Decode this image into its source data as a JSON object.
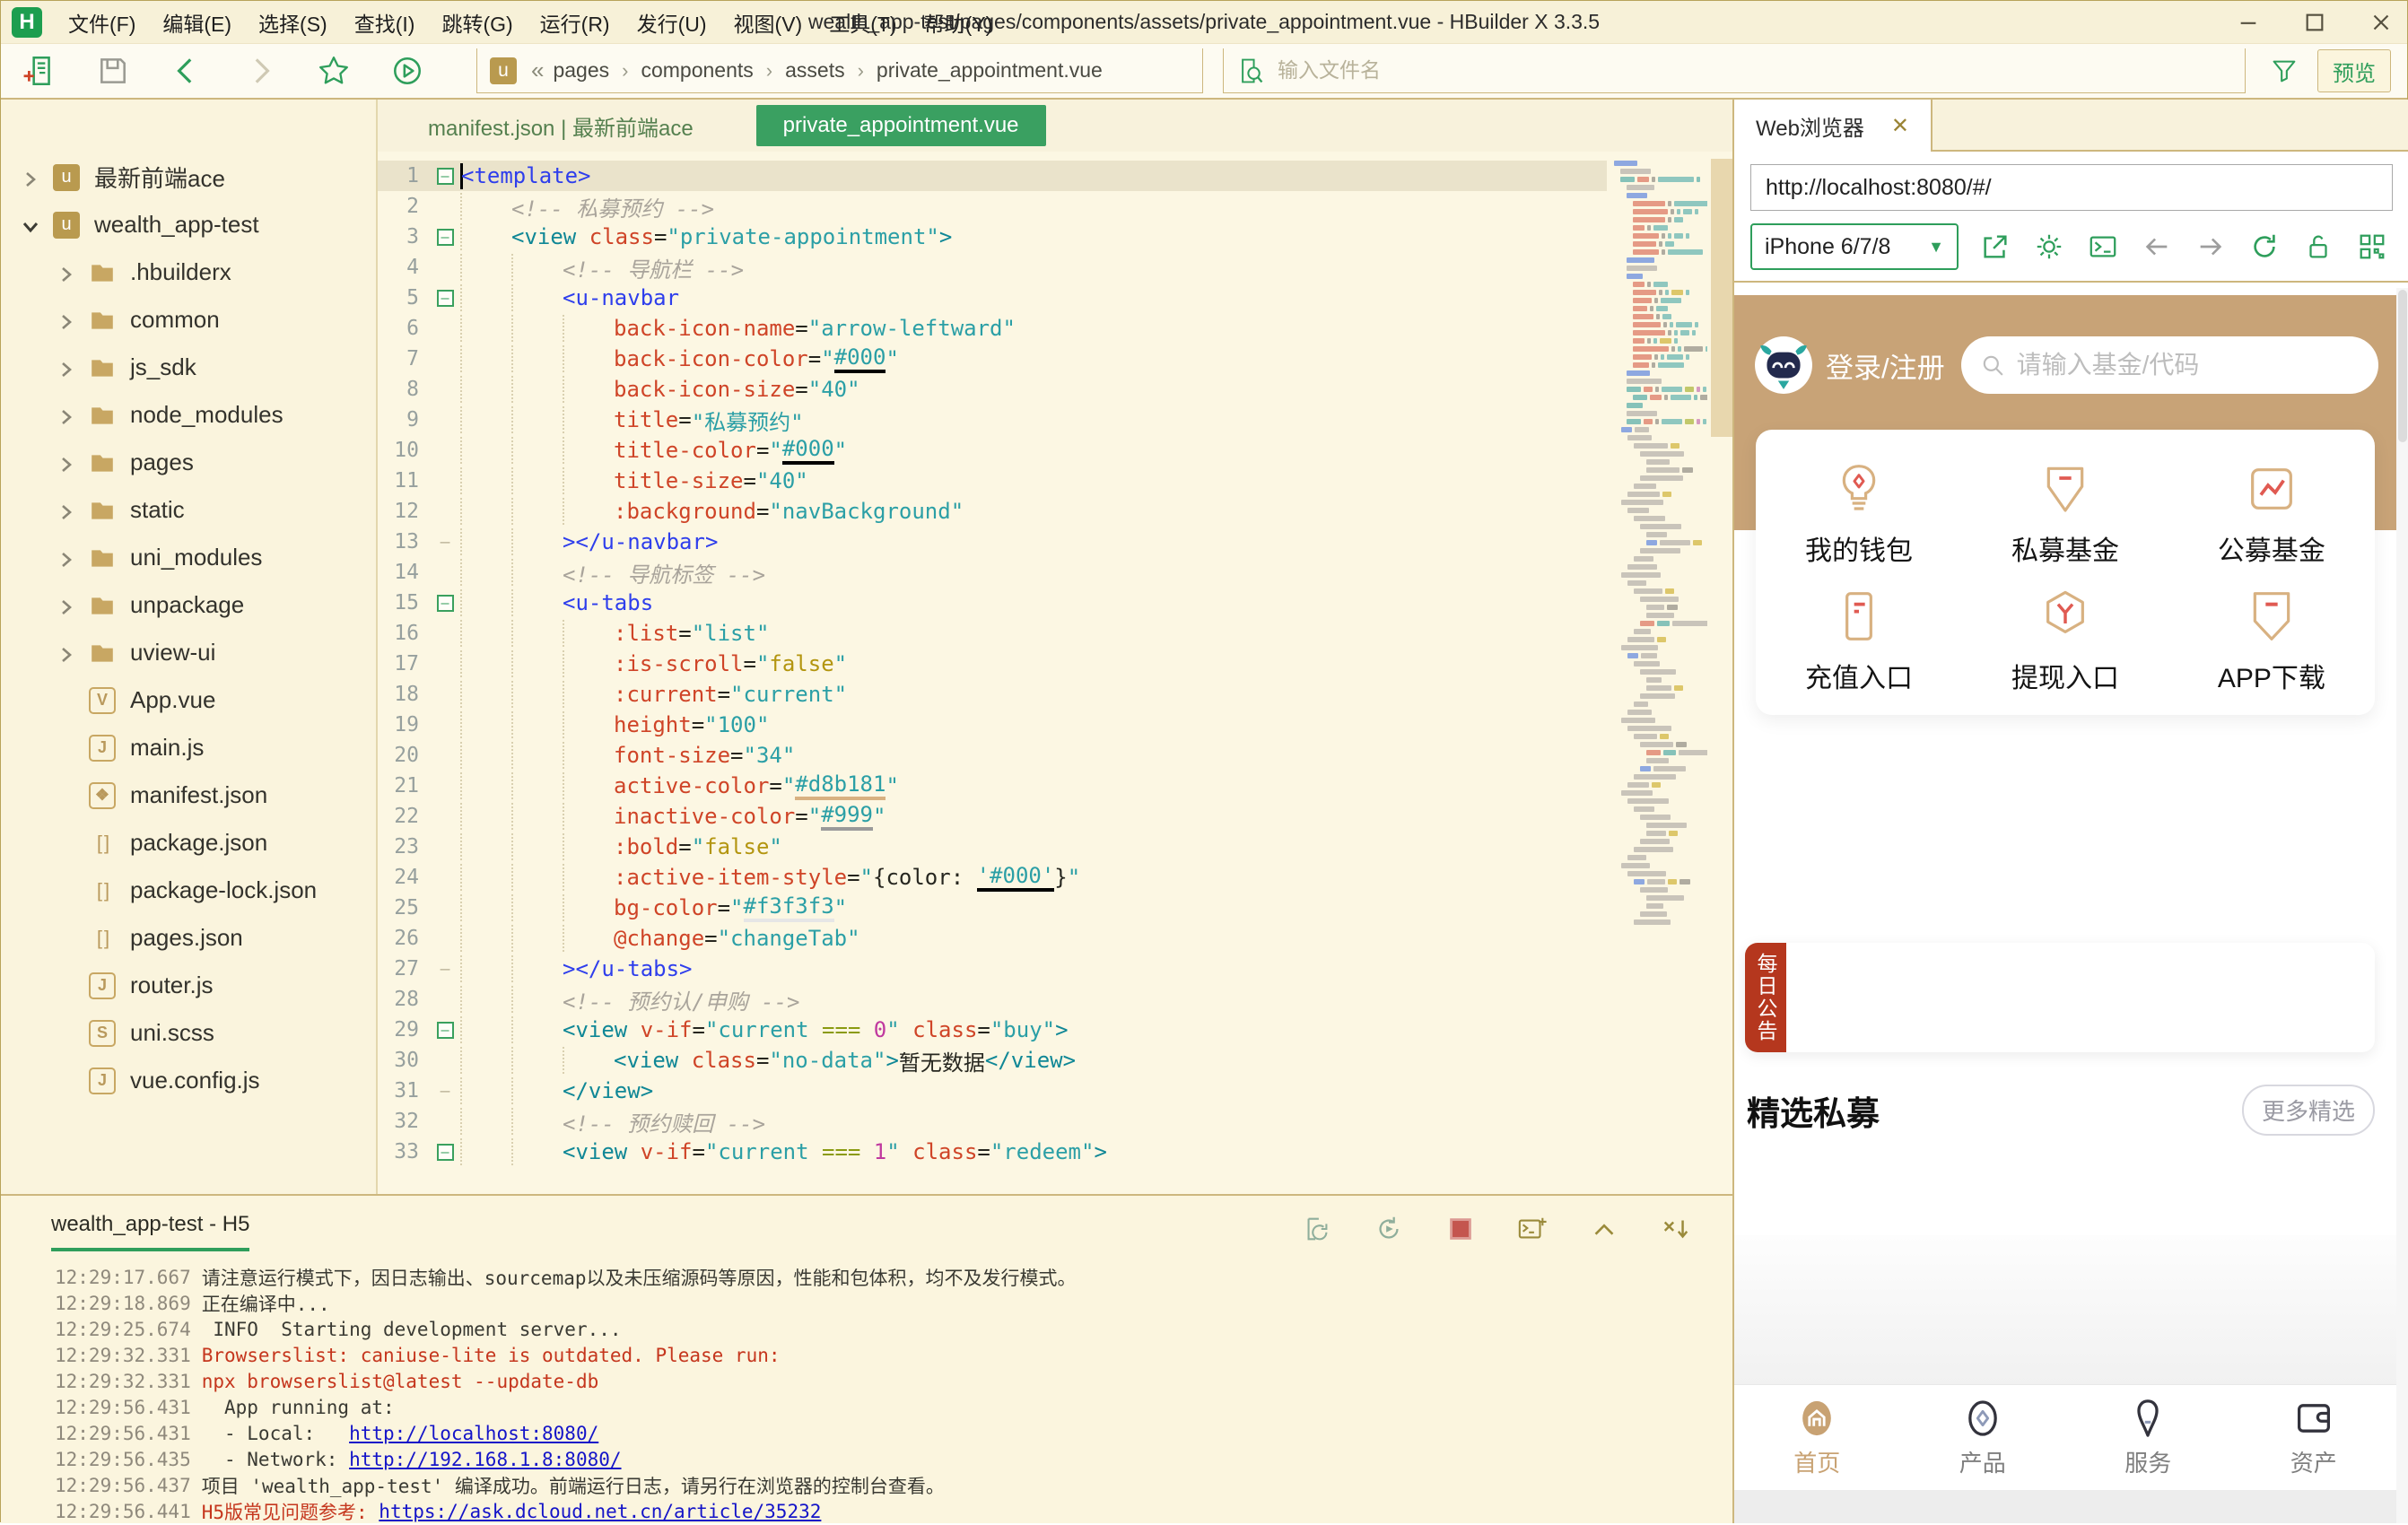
{
  "colors": {
    "accent_green": "#2e9e5b",
    "tab_green": "#3aa061",
    "app_tan": "#c8a377",
    "badge_red": "#b5371e",
    "gold_border": "#cdb77e",
    "active_color_value": "#d8b181"
  },
  "window": {
    "logo_letter": "H",
    "menus": [
      "文件(F)",
      "编辑(E)",
      "选择(S)",
      "查找(I)",
      "跳转(G)",
      "运行(R)",
      "发行(U)",
      "视图(V)",
      "工具(T)",
      "帮助(Y)"
    ],
    "title": "wealth_app-test/pages/components/assets/private_appointment.vue - HBuilder X 3.3.5"
  },
  "toolbar": {
    "home_crumb": "«",
    "crumbs": [
      "pages",
      "components",
      "assets",
      "private_appointment.vue"
    ],
    "search_placeholder": "输入文件名",
    "preview_label": "预览"
  },
  "explorer": {
    "items": [
      {
        "label": "最新前端ace",
        "kind": "project",
        "expanded": false
      },
      {
        "label": "wealth_app-test",
        "kind": "project",
        "expanded": true
      },
      {
        "label": ".hbuilderx",
        "kind": "folder"
      },
      {
        "label": "common",
        "kind": "folder"
      },
      {
        "label": "js_sdk",
        "kind": "folder"
      },
      {
        "label": "node_modules",
        "kind": "folder"
      },
      {
        "label": "pages",
        "kind": "folder"
      },
      {
        "label": "static",
        "kind": "folder"
      },
      {
        "label": "uni_modules",
        "kind": "folder"
      },
      {
        "label": "unpackage",
        "kind": "folder"
      },
      {
        "label": "uview-ui",
        "kind": "folder"
      },
      {
        "label": "App.vue",
        "kind": "file",
        "icon": "vue"
      },
      {
        "label": "main.js",
        "kind": "file",
        "icon": "js"
      },
      {
        "label": "manifest.json",
        "kind": "file",
        "icon": "manifest"
      },
      {
        "label": "package.json",
        "kind": "file",
        "icon": "brackets"
      },
      {
        "label": "package-lock.json",
        "kind": "file",
        "icon": "brackets"
      },
      {
        "label": "pages.json",
        "kind": "file",
        "icon": "brackets"
      },
      {
        "label": "router.js",
        "kind": "file",
        "icon": "js"
      },
      {
        "label": "uni.scss",
        "kind": "file",
        "icon": "scss"
      },
      {
        "label": "vue.config.js",
        "kind": "file",
        "icon": "js"
      }
    ]
  },
  "editor": {
    "tabs": [
      {
        "label": "manifest.json | 最新前端ace",
        "active": false
      },
      {
        "label": "private_appointment.vue",
        "active": true
      }
    ],
    "lines": [
      {
        "n": 1,
        "i": 0,
        "f": "m",
        "cur": true,
        "tk": [
          [
            "<template>",
            "tb"
          ]
        ]
      },
      {
        "n": 2,
        "i": 1,
        "tk": [
          [
            "<!-- 私募预约 -->",
            "cm"
          ]
        ]
      },
      {
        "n": 3,
        "i": 1,
        "f": "m",
        "tk": [
          [
            "<view ",
            "tt"
          ],
          [
            "class",
            "at"
          ],
          [
            "=",
            "pl"
          ],
          [
            "\"private-appointment\"",
            "st"
          ],
          [
            ">",
            "tt"
          ]
        ]
      },
      {
        "n": 4,
        "i": 2,
        "tk": [
          [
            "<!-- 导航栏 -->",
            "cm"
          ]
        ]
      },
      {
        "n": 5,
        "i": 2,
        "f": "m",
        "tk": [
          [
            "<u-navbar",
            "tb"
          ]
        ]
      },
      {
        "n": 6,
        "i": 3,
        "tk": [
          [
            "back-icon-name",
            "at"
          ],
          [
            "=",
            "pl"
          ],
          [
            "\"arrow-leftward\"",
            "st"
          ]
        ]
      },
      {
        "n": 7,
        "i": 3,
        "tk": [
          [
            "back-icon-color",
            "at"
          ],
          [
            "=",
            "pl"
          ],
          [
            "\"",
            "st"
          ],
          [
            "#000",
            "st ub"
          ],
          [
            "\"",
            "st"
          ]
        ]
      },
      {
        "n": 8,
        "i": 3,
        "tk": [
          [
            "back-icon-size",
            "at"
          ],
          [
            "=",
            "pl"
          ],
          [
            "\"40\"",
            "st"
          ]
        ]
      },
      {
        "n": 9,
        "i": 3,
        "tk": [
          [
            "title",
            "at"
          ],
          [
            "=",
            "pl"
          ],
          [
            "\"私募预约\"",
            "st"
          ]
        ]
      },
      {
        "n": 10,
        "i": 3,
        "tk": [
          [
            "title-color",
            "at"
          ],
          [
            "=",
            "pl"
          ],
          [
            "\"",
            "st"
          ],
          [
            "#000",
            "st ub"
          ],
          [
            "\"",
            "st"
          ]
        ]
      },
      {
        "n": 11,
        "i": 3,
        "tk": [
          [
            "title-size",
            "at"
          ],
          [
            "=",
            "pl"
          ],
          [
            "\"40\"",
            "st"
          ]
        ]
      },
      {
        "n": 12,
        "i": 3,
        "tk": [
          [
            ":background",
            "at"
          ],
          [
            "=",
            "pl"
          ],
          [
            "\"navBackground\"",
            "st"
          ]
        ]
      },
      {
        "n": 13,
        "i": 2,
        "f": "e",
        "tk": [
          [
            "></u-navbar>",
            "tb"
          ]
        ]
      },
      {
        "n": 14,
        "i": 2,
        "tk": [
          [
            "<!-- 导航标签 -->",
            "cm"
          ]
        ]
      },
      {
        "n": 15,
        "i": 2,
        "f": "m",
        "tk": [
          [
            "<u-tabs",
            "tb"
          ]
        ]
      },
      {
        "n": 16,
        "i": 3,
        "tk": [
          [
            ":list",
            "at"
          ],
          [
            "=",
            "pl"
          ],
          [
            "\"list\"",
            "st"
          ]
        ]
      },
      {
        "n": 17,
        "i": 3,
        "tk": [
          [
            ":is-scroll",
            "at"
          ],
          [
            "=",
            "pl"
          ],
          [
            "\"",
            "st"
          ],
          [
            "false",
            "kf"
          ],
          [
            "\"",
            "st"
          ]
        ]
      },
      {
        "n": 18,
        "i": 3,
        "tk": [
          [
            ":current",
            "at"
          ],
          [
            "=",
            "pl"
          ],
          [
            "\"current\"",
            "st"
          ]
        ]
      },
      {
        "n": 19,
        "i": 3,
        "tk": [
          [
            "height",
            "at"
          ],
          [
            "=",
            "pl"
          ],
          [
            "\"100\"",
            "st"
          ]
        ]
      },
      {
        "n": 20,
        "i": 3,
        "tk": [
          [
            "font-size",
            "at"
          ],
          [
            "=",
            "pl"
          ],
          [
            "\"34\"",
            "st"
          ]
        ]
      },
      {
        "n": 21,
        "i": 3,
        "tk": [
          [
            "active-color",
            "at"
          ],
          [
            "=",
            "pl"
          ],
          [
            "\"",
            "st"
          ],
          [
            "#d8b181",
            "st ut"
          ],
          [
            "\"",
            "st"
          ]
        ]
      },
      {
        "n": 22,
        "i": 3,
        "tk": [
          [
            "inactive-color",
            "at"
          ],
          [
            "=",
            "pl"
          ],
          [
            "\"",
            "st"
          ],
          [
            "#999",
            "st ug"
          ],
          [
            "\"",
            "st"
          ]
        ]
      },
      {
        "n": 23,
        "i": 3,
        "tk": [
          [
            ":bold",
            "at"
          ],
          [
            "=",
            "pl"
          ],
          [
            "\"",
            "st"
          ],
          [
            "false",
            "kf"
          ],
          [
            "\"",
            "st"
          ]
        ]
      },
      {
        "n": 24,
        "i": 3,
        "tk": [
          [
            ":active-item-style",
            "at"
          ],
          [
            "=",
            "pl"
          ],
          [
            "\"",
            "st"
          ],
          [
            "{color: ",
            "pl"
          ],
          [
            "'#000'",
            "st ub"
          ],
          [
            "}",
            "pl"
          ],
          [
            "\"",
            "st"
          ]
        ]
      },
      {
        "n": 25,
        "i": 3,
        "tk": [
          [
            "bg-color",
            "at"
          ],
          [
            "=",
            "pl"
          ],
          [
            "\"",
            "st"
          ],
          [
            "#f3f3f3",
            "st uf"
          ],
          [
            "\"",
            "st"
          ]
        ]
      },
      {
        "n": 26,
        "i": 3,
        "tk": [
          [
            "@change",
            "at"
          ],
          [
            "=",
            "pl"
          ],
          [
            "\"changeTab\"",
            "st"
          ]
        ]
      },
      {
        "n": 27,
        "i": 2,
        "f": "e",
        "tk": [
          [
            "></u-tabs>",
            "tb"
          ]
        ]
      },
      {
        "n": 28,
        "i": 2,
        "tk": [
          [
            "<!-- 预约认/申购 -->",
            "cm"
          ]
        ]
      },
      {
        "n": 29,
        "i": 2,
        "f": "m",
        "tk": [
          [
            "<view ",
            "tt"
          ],
          [
            "v-if",
            "at"
          ],
          [
            "=",
            "pl"
          ],
          [
            "\"current ",
            "st"
          ],
          [
            "=== ",
            "op"
          ],
          [
            "0",
            "nm"
          ],
          [
            "\"",
            "st"
          ],
          [
            " ",
            "pl"
          ],
          [
            "class",
            "at"
          ],
          [
            "=",
            "pl"
          ],
          [
            "\"buy\"",
            "st"
          ],
          [
            ">",
            "tt"
          ]
        ]
      },
      {
        "n": 30,
        "i": 3,
        "tk": [
          [
            "<view ",
            "tt"
          ],
          [
            "class",
            "at"
          ],
          [
            "=",
            "pl"
          ],
          [
            "\"no-data\"",
            "st"
          ],
          [
            ">",
            "tt"
          ],
          [
            "暂无数据",
            "pl"
          ],
          [
            "</view>",
            "tt"
          ]
        ]
      },
      {
        "n": 31,
        "i": 2,
        "f": "e",
        "tk": [
          [
            "</view>",
            "tt"
          ]
        ]
      },
      {
        "n": 32,
        "i": 2,
        "tk": [
          [
            "<!-- 预约赎回 -->",
            "cm"
          ]
        ]
      },
      {
        "n": 33,
        "i": 2,
        "f": "m",
        "tk": [
          [
            "<view ",
            "tt"
          ],
          [
            "v-if",
            "at"
          ],
          [
            "=",
            "pl"
          ],
          [
            "\"current ",
            "st"
          ],
          [
            "=== ",
            "op"
          ],
          [
            "1",
            "nm"
          ],
          [
            "\"",
            "st"
          ],
          [
            " ",
            "pl"
          ],
          [
            "class",
            "at"
          ],
          [
            "=",
            "pl"
          ],
          [
            "\"redeem\"",
            "st"
          ],
          [
            ">",
            "tt"
          ]
        ]
      }
    ]
  },
  "browser": {
    "tab_label": "Web浏览器",
    "close_glyph": "✕",
    "url": "http://localhost:8080/#/",
    "device": "iPhone 6/7/8",
    "toolbar_icons": [
      "open-external",
      "gear",
      "terminal",
      "back",
      "forward",
      "refresh",
      "lock",
      "qrcode"
    ]
  },
  "app": {
    "login_label": "登录/注册",
    "search_placeholder": "请输入基金/代码",
    "grid": [
      {
        "label": "我的钱包",
        "icon": "wallet"
      },
      {
        "label": "私募基金",
        "icon": "shield"
      },
      {
        "label": "公募基金",
        "icon": "chart"
      },
      {
        "label": "充值入口",
        "icon": "card"
      },
      {
        "label": "提现入口",
        "icon": "hexy"
      },
      {
        "label": "APP下载",
        "icon": "badge"
      }
    ],
    "announcement": "每日公告",
    "featured_title": "精选私募",
    "more_label": "更多精选",
    "tabbar": [
      {
        "label": "首页",
        "icon": "home",
        "active": true
      },
      {
        "label": "产品",
        "icon": "product",
        "active": false
      },
      {
        "label": "服务",
        "icon": "service",
        "active": false
      },
      {
        "label": "资产",
        "icon": "assets",
        "active": false
      }
    ]
  },
  "console": {
    "tab": "wealth_app-test - H5",
    "icons": [
      "doc-refresh",
      "restart",
      "stop",
      "terminal-plus",
      "collapse-up",
      "clear"
    ],
    "logs": [
      {
        "t": "12:29:17.667",
        "parts": [
          {
            "x": "请注意运行模式下，因日志输出、sourcemap以及未压缩源码等原因，性能和包体积，均不及发行模式。",
            "c": "p"
          }
        ]
      },
      {
        "t": "12:29:18.869",
        "parts": [
          {
            "x": "正在编译中...",
            "c": "p"
          }
        ]
      },
      {
        "t": "12:29:25.674",
        "parts": [
          {
            "x": " INFO  Starting development server...",
            "c": "p"
          }
        ]
      },
      {
        "t": "12:29:32.331",
        "parts": [
          {
            "x": "Browserslist: caniuse-lite is outdated. Please run:",
            "c": "r"
          }
        ]
      },
      {
        "t": "12:29:32.331",
        "parts": [
          {
            "x": "npx browserslist@latest --update-db",
            "c": "r"
          }
        ]
      },
      {
        "t": "12:29:56.431",
        "parts": [
          {
            "x": "  App running at:",
            "c": "p"
          }
        ]
      },
      {
        "t": "12:29:56.431",
        "parts": [
          {
            "x": "  - Local:   ",
            "c": "p"
          },
          {
            "x": "http://localhost:8080/",
            "c": "l"
          }
        ]
      },
      {
        "t": "12:29:56.435",
        "parts": [
          {
            "x": "  - Network: ",
            "c": "p"
          },
          {
            "x": "http://192.168.1.8:8080/",
            "c": "l"
          }
        ]
      },
      {
        "t": "12:29:56.437",
        "parts": [
          {
            "x": "项目 'wealth_app-test' 编译成功。前端运行日志，请另行在浏览器的控制台查看。",
            "c": "p"
          }
        ]
      },
      {
        "t": "12:29:56.441",
        "parts": [
          {
            "x": "H5版常见问题参考: ",
            "c": "r"
          },
          {
            "x": "https://ask.dcloud.net.cn/article/35232",
            "c": "l"
          }
        ]
      }
    ]
  }
}
